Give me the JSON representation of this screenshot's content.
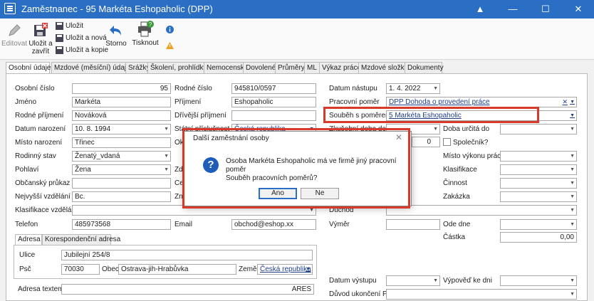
{
  "window": {
    "title": "Zaměstnanec - 95 Markéta Eshopaholic  (DPP)",
    "controls": [
      "▲",
      "—",
      "☐",
      "✕"
    ]
  },
  "ribbon": {
    "edit": "Editovat",
    "save_close_1": "Uložit a",
    "save_close_2": "zavřít",
    "save": "Uložit",
    "save_new": "Uložit a nová",
    "save_copy": "Uložit a kopie",
    "cancel": "Storno",
    "print": "Tisknout"
  },
  "tabs": [
    "Osobní údaje",
    "Mzdové (měsíční) údaje",
    "Srážky",
    "Školení, prohlídky",
    "Nemocenské",
    "Dovolené",
    "Průměry",
    "ML",
    "Výkaz práce",
    "Mzdové složky",
    "Dokumenty"
  ],
  "form": {
    "osobni_cislo_lbl": "Osobní číslo",
    "osobni_cislo": "95",
    "jmeno_lbl": "Jméno",
    "jmeno": "Markéta",
    "rodne_prijmeni_lbl": "Rodné příjmení",
    "rodne_prijmeni": "Nováková",
    "datum_narozeni_lbl": "Datum narození",
    "datum_narozeni": "10. 8. 1994",
    "misto_narozeni_lbl": "Místo narození",
    "misto_narozeni": "Třinec",
    "rodinny_stav_lbl": "Rodinný stav",
    "rodinny_stav": "Ženatý_vdaná",
    "pohlavi_lbl": "Pohlaví",
    "pohlavi": "Žena",
    "obcansky_prukaz_lbl": "Občanský průkaz",
    "vzdelani_lbl": "Nejvyšší vzdělání",
    "vzdelani": "Bc.",
    "klasifikace_vzdelani_lbl": "Klasifikace vzdělání",
    "telefon_lbl": "Telefon",
    "telefon": "485973568",
    "rodne_cislo_lbl": "Rodné číslo",
    "rodne_cislo": "945810/0597",
    "prijmeni_lbl": "Příjmení",
    "prijmeni": "Eshopaholic",
    "drivejsi_prijmeni_lbl": "Dřívější příjmení",
    "statni_prislusnost_lbl": "Státní příslušnost",
    "statni_prislusnost": "Česká republika",
    "ok_lbl": "Ok",
    "zd_lbl": "Zd",
    "ce_lbl": "Ce",
    "ma_lbl": "Ma",
    "zn_lbl": "Zn",
    "email_lbl": "Email",
    "email": "obchod@eshop.xx",
    "datum_nastupu_lbl": "Datum nástupu",
    "datum_nastupu": "1. 4. 2022",
    "pracovni_pomer_lbl": "Pracovní poměr",
    "pracovni_pomer": "DPP Dohoda o provedení práce",
    "soubeh_lbl": "Souběh s poměrem",
    "soubeh": "5 Markéta Eshopaholic",
    "zkusebni_doba_lbl": "Zkušební doba do",
    "zkusebni_num": "0",
    "doba_urcita_lbl": "Doba určitá do",
    "spolecnik_lbl": "Společník?",
    "misto_vykonu_lbl": "Místo výkonu práce",
    "klasifikace_lbl": "Klasifikace",
    "cinnost_lbl": "Činnost",
    "zakazka_lbl": "Zakázka",
    "duchod_lbl": "Důchod",
    "vymer_lbl": "Výměr",
    "ode_dne_lbl": "Ode dne",
    "castka_lbl": "Částka",
    "castka": "0,00",
    "datum_vystupu_lbl": "Datum výstupu",
    "vypoved_lbl": "Výpověď ke dni",
    "duvod_lbl": "Důvod ukončení PP"
  },
  "address": {
    "tab_adresa": "Adresa",
    "tab_korespondencni": "Korespondenční adresa",
    "ulice_lbl": "Ulice",
    "ulice": "Jubilejní 254/8",
    "psc_lbl": "Psč",
    "psc": "70030",
    "obec_lbl": "Obec",
    "obec": "Ostrava-jih-Hrabůvka",
    "zeme_lbl": "Země",
    "zeme": "Česká republika",
    "adresa_textem_lbl": "Adresa textem",
    "ares": "ARES"
  },
  "dialog": {
    "title": "Další zaměstnání osoby",
    "line1": "Osoba Markéta Eshopaholic  má ve firmě jiný pracovní poměr",
    "line2": "Souběh pracovních poměrů?",
    "yes": "Ano",
    "no": "Ne",
    "close": "✕",
    "icon": "?"
  }
}
